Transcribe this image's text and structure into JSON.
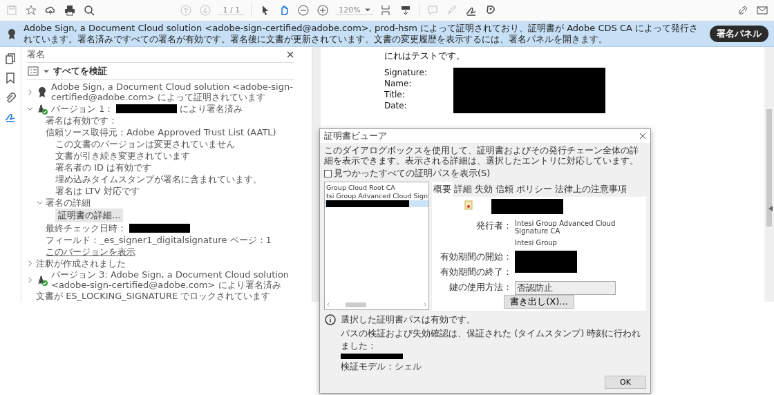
{
  "toolbar": {
    "page": "1 / 1",
    "zoom": "120%"
  },
  "banner": {
    "text": "Adobe Sign, a Document Cloud solution <adobe-sign-certified@adobe.com>, prod-hsm によって証明されており、証明書が Adobe CDS CA によって発行されています。署名済みですべての署名が有効です。署名後に文書が更新されています。文書の変更履歴を表示するには、署名パネルを開きます。",
    "button": "署名パネル"
  },
  "rail": [
    {
      "selected": false
    },
    {
      "selected": false
    },
    {
      "selected": false
    },
    {
      "selected": true
    }
  ],
  "panel": {
    "title": "署名",
    "verify_all": "すべてを検証",
    "tree": [
      {
        "kind": "certified",
        "expanded": false,
        "text": "Adobe Sign, a Document Cloud solution <adobe-sign-certified@adobe.com> によって証明されています"
      },
      {
        "kind": "signed",
        "expanded": true,
        "text": "バージョン 1：",
        "redacted": true,
        "suffix": "により署名済み",
        "children": [
          {
            "kind": "text",
            "text": "署名は有効です："
          },
          {
            "kind": "text",
            "text": "信頼ソース取得元：Adobe Approved Trust List (AATL)",
            "children": [
              {
                "kind": "text",
                "text": "この文書のバージョンは変更されていません"
              },
              {
                "kind": "text",
                "text": "文書が引き続き変更されています"
              },
              {
                "kind": "text",
                "text": "署名者の ID は有効です"
              },
              {
                "kind": "text",
                "text": "埋め込みタイムスタンプが署名に含まれています。"
              },
              {
                "kind": "text",
                "text": "署名は LTV 対応です"
              }
            ]
          },
          {
            "kind": "node",
            "expanded": true,
            "text": "署名の詳細",
            "children": [
              {
                "kind": "button",
                "text": "証明書の詳細..."
              }
            ]
          },
          {
            "kind": "text",
            "text": "最終チェック日時：",
            "redacted": true
          },
          {
            "kind": "text",
            "text": "フィールド：_es_signer1_digitalsignature ページ：1"
          },
          {
            "kind": "link",
            "text": "このバージョンを表示"
          }
        ]
      },
      {
        "kind": "node",
        "expanded": false,
        "text": "注釈が作成されました"
      },
      {
        "kind": "signed",
        "expanded": false,
        "text": "バージョン 3: Adobe Sign, a Document Cloud solution <adobe-sign-certified@adobe.com> により署名済み"
      },
      {
        "kind": "text",
        "text": "文書が ES_LOCKING_SIGNATURE でロックされています"
      }
    ]
  },
  "document": {
    "heading": "にれはテストです。",
    "fields": [
      "Signature:",
      "Name:",
      "Title:",
      "Date:"
    ]
  },
  "dialog": {
    "title": "証明書ビューア",
    "description": "このダイアログボックスを使用して、証明書およびその発行チェーン全体の詳細を表示できます。表示される詳細は、選択したエントリに対応しています。",
    "show_all": {
      "label": "見つかったすべての証明パスを表示(S)",
      "checked": false
    },
    "chain": [
      {
        "text": "Group Cloud Root CA",
        "selected": false
      },
      {
        "text": "tsi Group Advanced Cloud Sign",
        "selected": false
      },
      {
        "redacted": true,
        "selected": true
      }
    ],
    "tabs": [
      {
        "label": "概要",
        "selected": true
      },
      {
        "label": "詳細",
        "selected": false
      },
      {
        "label": "失効",
        "selected": false
      },
      {
        "label": "信頼",
        "selected": false
      },
      {
        "label": "ポリシー",
        "selected": false
      },
      {
        "label": "法律上の注意事項",
        "selected": false
      }
    ],
    "issuer_label": "発行者：",
    "issuer": [
      "Intesi Group Advanced Cloud Signature CA",
      "Intesi Group"
    ],
    "valid_from": "有効期間の開始：",
    "valid_to": "有効期間の終了：",
    "key_usage_label": "鍵の使用方法：",
    "key_usage": "否認防止",
    "export": "書き出し(X)...",
    "status": "選択した証明書パスは有効です。",
    "status_detail": "パスの検証および失効確認は、保証された (タイムスタンプ) 時刻に行われました：",
    "model": "検証モデル：シェル",
    "ok": "OK"
  }
}
